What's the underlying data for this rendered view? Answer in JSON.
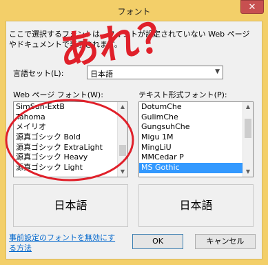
{
  "window": {
    "title": "フォント",
    "close_label": "✕"
  },
  "description": "ここで選択するフォントは、フォントが設定されていない Web ページやドキュメントで表示されます。",
  "language": {
    "label": "言語セット(L):",
    "value": "日本語"
  },
  "web_fonts": {
    "label": "Web ページ フォント(W):",
    "items": [
      "SimSun-ExtB",
      "Tahoma",
      "メイリオ",
      "源真ゴシック Bold",
      "源真ゴシック ExtraLight",
      "源真ゴシック Heavy",
      "源真ゴシック Light"
    ],
    "preview": "日本語"
  },
  "text_fonts": {
    "label": "テキスト形式フォント(P):",
    "items": [
      "DotumChe",
      "GulimChe",
      "GungsuhChe",
      "Migu 1M",
      "MingLiU",
      "MMCedar P",
      "MS Gothic"
    ],
    "selected": "MS Gothic",
    "preview": "日本語"
  },
  "link": {
    "text": "事前設定のフォントを無効にする方法"
  },
  "buttons": {
    "ok": "OK",
    "cancel": "キャンセル"
  },
  "annotation": {
    "text": "あれ？",
    "color": "#e0202a"
  },
  "colors": {
    "accent": "#3399ff",
    "window_frame": "#f3cf69",
    "annotation": "#e0202a"
  }
}
